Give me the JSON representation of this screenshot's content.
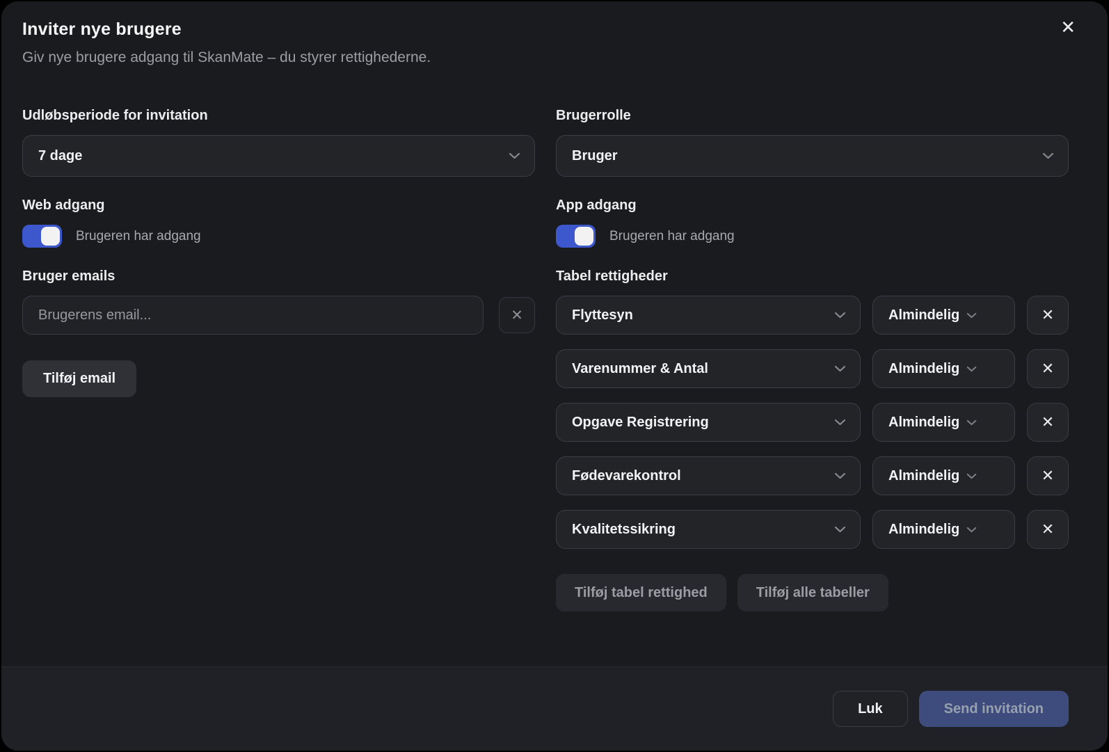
{
  "modal": {
    "title": "Inviter nye brugere",
    "subtitle": "Giv nye brugere adgang til SkanMate – du styrer rettighederne."
  },
  "icons": {
    "close": "✕",
    "remove": "✕"
  },
  "fields": {
    "expiry": {
      "label": "Udløbsperiode for invitation",
      "value": "7 dage"
    },
    "role": {
      "label": "Brugerrolle",
      "value": "Bruger"
    },
    "web_access": {
      "label": "Web adgang",
      "toggle_label": "Brugeren har adgang",
      "enabled": true
    },
    "app_access": {
      "label": "App adgang",
      "toggle_label": "Brugeren har adgang",
      "enabled": true
    },
    "emails": {
      "label": "Bruger emails",
      "placeholder": "Brugerens email...",
      "add_button": "Tilføj email"
    },
    "table_rights": {
      "label": "Tabel rettigheder",
      "rows": [
        {
          "table": "Flyttesyn",
          "permission": "Almindelig"
        },
        {
          "table": "Varenummer & Antal",
          "permission": "Almindelig"
        },
        {
          "table": "Opgave Registrering",
          "permission": "Almindelig"
        },
        {
          "table": "Fødevarekontrol",
          "permission": "Almindelig"
        },
        {
          "table": "Kvalitetssikring",
          "permission": "Almindelig"
        }
      ],
      "add_right_button": "Tilføj tabel rettighed",
      "add_all_button": "Tilføj alle tabeller"
    }
  },
  "footer": {
    "close_button": "Luk",
    "send_button": "Send invitation"
  },
  "colors": {
    "accent": "#3d57cc",
    "send_button_bg": "#3d4b7d"
  }
}
